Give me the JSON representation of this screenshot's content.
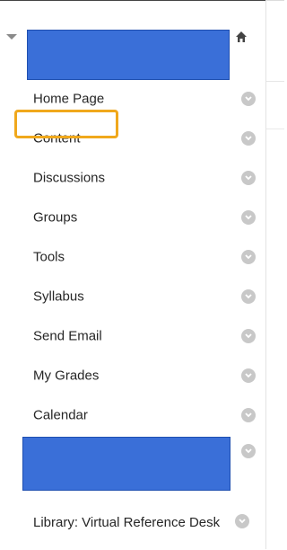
{
  "course": {
    "title_redacted": true,
    "color": "#3a6fd8",
    "collapse_icon": "caret-down-icon",
    "home_icon": "home-icon"
  },
  "menu": {
    "items": [
      {
        "label": "Home Page"
      },
      {
        "label": "Content"
      },
      {
        "label": "Discussions"
      },
      {
        "label": "Groups"
      },
      {
        "label": "Tools"
      },
      {
        "label": "Syllabus"
      },
      {
        "label": "Send Email"
      },
      {
        "label": "My Grades"
      },
      {
        "label": "Calendar"
      },
      {
        "label": ""
      },
      {
        "label": "Library: Virtual Reference Desk"
      }
    ],
    "item_icon": "chevron-down-circle-icon"
  },
  "annotation": {
    "highlighted_item": "Content",
    "highlight_color": "#f0a81c"
  }
}
